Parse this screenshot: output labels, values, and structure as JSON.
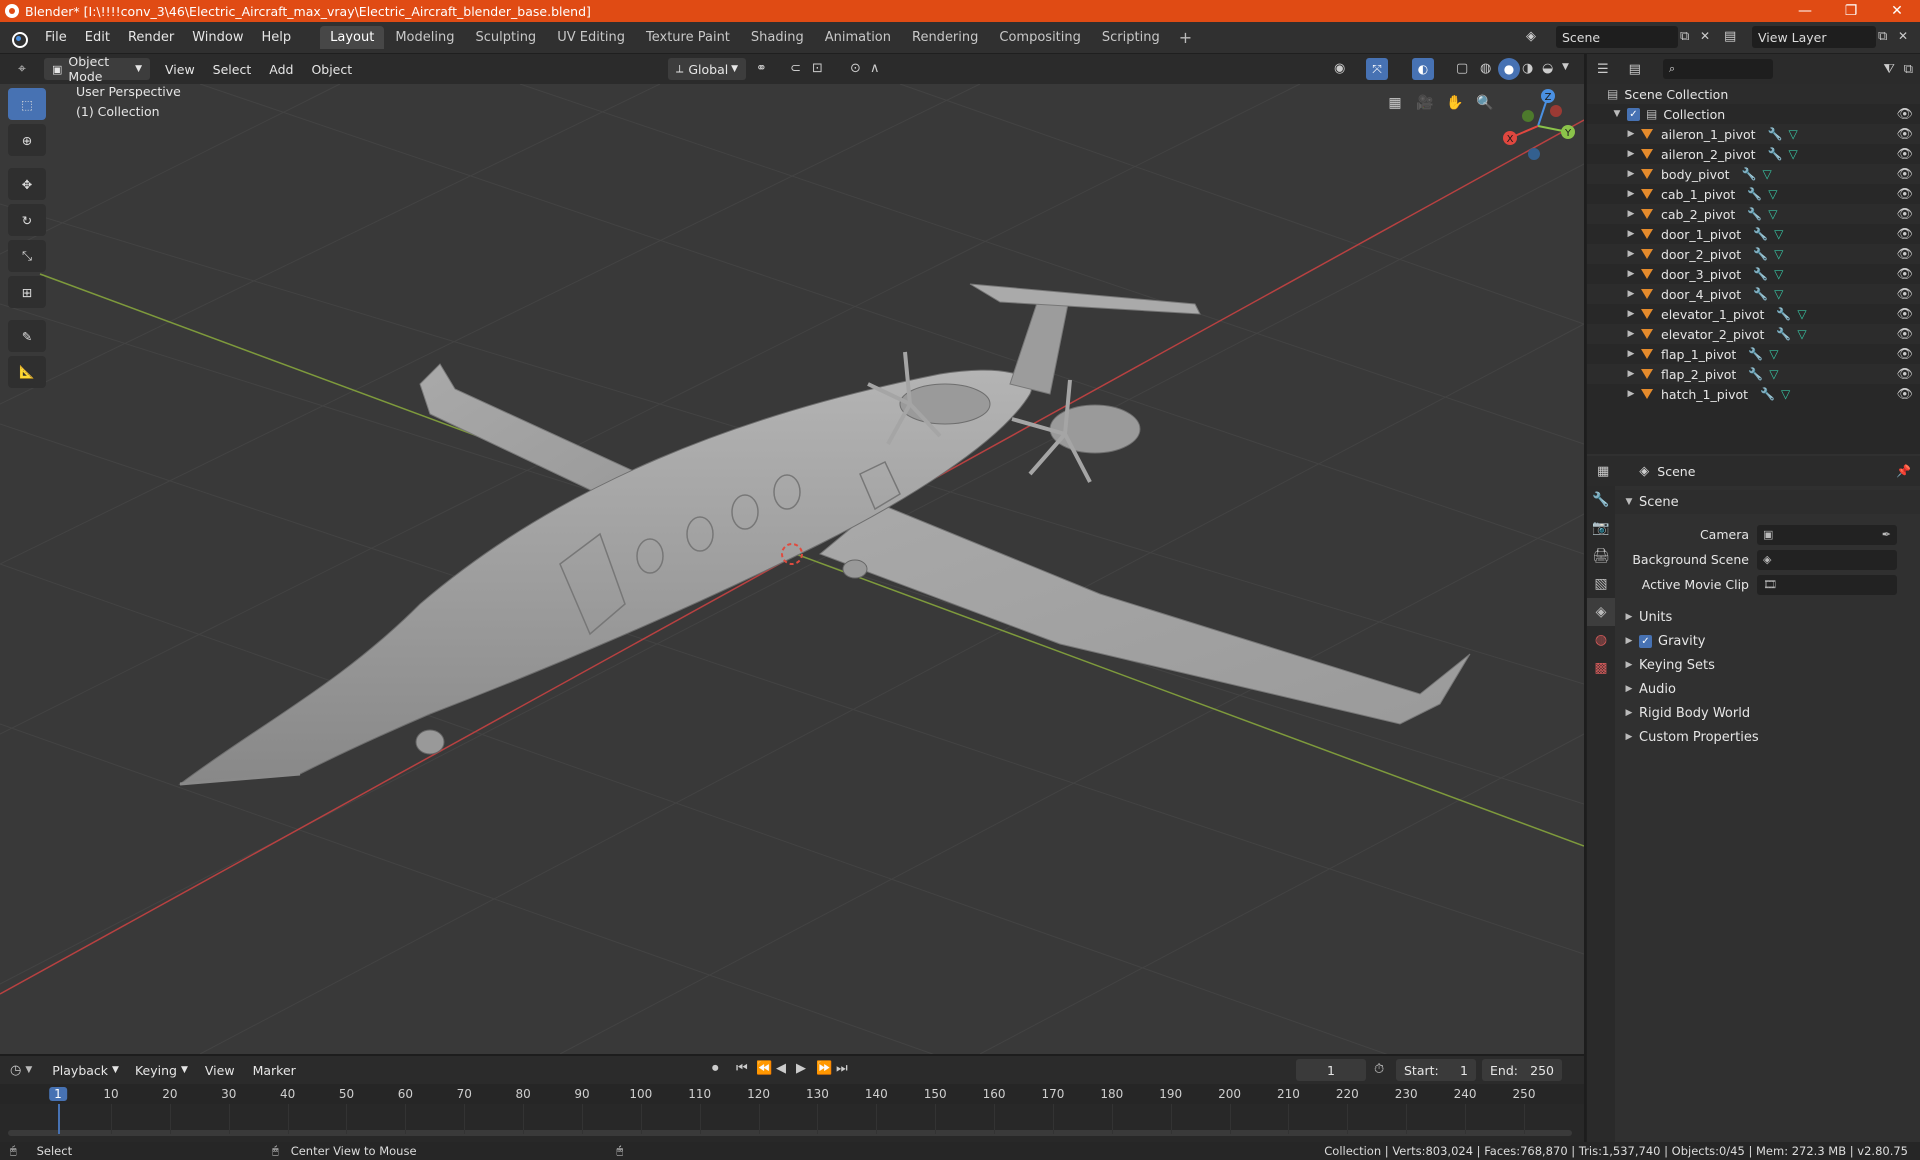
{
  "window": {
    "title": "Blender* [I:\\!!!!conv_3\\46\\Electric_Aircraft_max_vray\\Electric_Aircraft_blender_base.blend]",
    "minimize": "—",
    "maximize": "❐",
    "close": "✕"
  },
  "menu": [
    "File",
    "Edit",
    "Render",
    "Window",
    "Help"
  ],
  "workspaces": [
    "Layout",
    "Modeling",
    "Sculpting",
    "UV Editing",
    "Texture Paint",
    "Shading",
    "Animation",
    "Rendering",
    "Compositing",
    "Scripting"
  ],
  "active_workspace": "Layout",
  "scene_field": "Scene",
  "view_layer_field": "View Layer",
  "viewport_header": {
    "mode": "Object Mode",
    "menus": [
      "View",
      "Select",
      "Add",
      "Object"
    ],
    "transform_orientation": "Global"
  },
  "viewport": {
    "perspective_label": "User Perspective",
    "collection_label": "(1) Collection",
    "axes": {
      "x": "X",
      "y": "Y",
      "z": "Z"
    }
  },
  "outliner": {
    "root": "Scene Collection",
    "collection": "Collection",
    "items": [
      "aileron_1_pivot",
      "aileron_2_pivot",
      "body_pivot",
      "cab_1_pivot",
      "cab_2_pivot",
      "door_1_pivot",
      "door_2_pivot",
      "door_3_pivot",
      "door_4_pivot",
      "elevator_1_pivot",
      "elevator_2_pivot",
      "flap_1_pivot",
      "flap_2_pivot",
      "hatch_1_pivot"
    ]
  },
  "properties": {
    "context": "Scene",
    "section": "Scene",
    "fields": [
      {
        "label": "Camera",
        "value": ""
      },
      {
        "label": "Background Scene",
        "value": ""
      },
      {
        "label": "Active Movie Clip",
        "value": ""
      }
    ],
    "panels": [
      "Units",
      "Gravity",
      "Keying Sets",
      "Audio",
      "Rigid Body World",
      "Custom Properties"
    ]
  },
  "timeline": {
    "menus": [
      "Playback",
      "Keying",
      "View",
      "Marker"
    ],
    "current_frame": "1",
    "start_label": "Start:",
    "start": "1",
    "end_label": "End:",
    "end": "250",
    "ticks": [
      "1",
      "10",
      "20",
      "30",
      "40",
      "50",
      "60",
      "70",
      "80",
      "90",
      "100",
      "110",
      "120",
      "130",
      "140",
      "150",
      "160",
      "170",
      "180",
      "190",
      "200",
      "210",
      "220",
      "230",
      "240",
      "250"
    ]
  },
  "status": {
    "left": "Select",
    "middle": "Center View to Mouse",
    "right": "Collection | Verts:803,024 | Faces:768,870 | Tris:1,537,740 | Objects:0/45 | Mem: 272.3 MB | v2.80.75"
  },
  "colors": {
    "accent": "#4772b3",
    "title_bar": "#e04b14",
    "x_axis": "#e0473f",
    "y_axis": "#8bc34a",
    "z_axis": "#4a90e2",
    "object_icon": "#e58b2c"
  }
}
